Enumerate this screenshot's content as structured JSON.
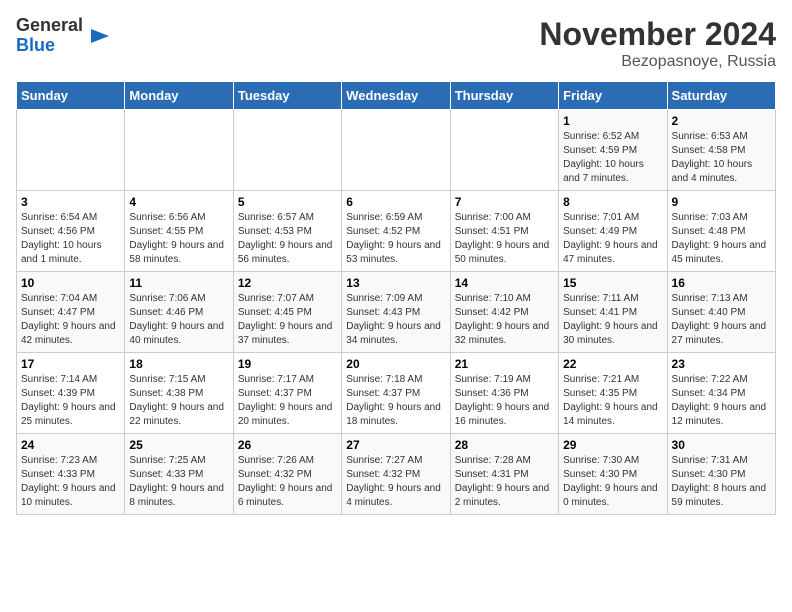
{
  "logo": {
    "general": "General",
    "blue": "Blue"
  },
  "title": "November 2024",
  "subtitle": "Bezopasnoye, Russia",
  "days_of_week": [
    "Sunday",
    "Monday",
    "Tuesday",
    "Wednesday",
    "Thursday",
    "Friday",
    "Saturday"
  ],
  "weeks": [
    [
      {
        "day": "",
        "info": ""
      },
      {
        "day": "",
        "info": ""
      },
      {
        "day": "",
        "info": ""
      },
      {
        "day": "",
        "info": ""
      },
      {
        "day": "",
        "info": ""
      },
      {
        "day": "1",
        "info": "Sunrise: 6:52 AM\nSunset: 4:59 PM\nDaylight: 10 hours and 7 minutes."
      },
      {
        "day": "2",
        "info": "Sunrise: 6:53 AM\nSunset: 4:58 PM\nDaylight: 10 hours and 4 minutes."
      }
    ],
    [
      {
        "day": "3",
        "info": "Sunrise: 6:54 AM\nSunset: 4:56 PM\nDaylight: 10 hours and 1 minute."
      },
      {
        "day": "4",
        "info": "Sunrise: 6:56 AM\nSunset: 4:55 PM\nDaylight: 9 hours and 58 minutes."
      },
      {
        "day": "5",
        "info": "Sunrise: 6:57 AM\nSunset: 4:53 PM\nDaylight: 9 hours and 56 minutes."
      },
      {
        "day": "6",
        "info": "Sunrise: 6:59 AM\nSunset: 4:52 PM\nDaylight: 9 hours and 53 minutes."
      },
      {
        "day": "7",
        "info": "Sunrise: 7:00 AM\nSunset: 4:51 PM\nDaylight: 9 hours and 50 minutes."
      },
      {
        "day": "8",
        "info": "Sunrise: 7:01 AM\nSunset: 4:49 PM\nDaylight: 9 hours and 47 minutes."
      },
      {
        "day": "9",
        "info": "Sunrise: 7:03 AM\nSunset: 4:48 PM\nDaylight: 9 hours and 45 minutes."
      }
    ],
    [
      {
        "day": "10",
        "info": "Sunrise: 7:04 AM\nSunset: 4:47 PM\nDaylight: 9 hours and 42 minutes."
      },
      {
        "day": "11",
        "info": "Sunrise: 7:06 AM\nSunset: 4:46 PM\nDaylight: 9 hours and 40 minutes."
      },
      {
        "day": "12",
        "info": "Sunrise: 7:07 AM\nSunset: 4:45 PM\nDaylight: 9 hours and 37 minutes."
      },
      {
        "day": "13",
        "info": "Sunrise: 7:09 AM\nSunset: 4:43 PM\nDaylight: 9 hours and 34 minutes."
      },
      {
        "day": "14",
        "info": "Sunrise: 7:10 AM\nSunset: 4:42 PM\nDaylight: 9 hours and 32 minutes."
      },
      {
        "day": "15",
        "info": "Sunrise: 7:11 AM\nSunset: 4:41 PM\nDaylight: 9 hours and 30 minutes."
      },
      {
        "day": "16",
        "info": "Sunrise: 7:13 AM\nSunset: 4:40 PM\nDaylight: 9 hours and 27 minutes."
      }
    ],
    [
      {
        "day": "17",
        "info": "Sunrise: 7:14 AM\nSunset: 4:39 PM\nDaylight: 9 hours and 25 minutes."
      },
      {
        "day": "18",
        "info": "Sunrise: 7:15 AM\nSunset: 4:38 PM\nDaylight: 9 hours and 22 minutes."
      },
      {
        "day": "19",
        "info": "Sunrise: 7:17 AM\nSunset: 4:37 PM\nDaylight: 9 hours and 20 minutes."
      },
      {
        "day": "20",
        "info": "Sunrise: 7:18 AM\nSunset: 4:37 PM\nDaylight: 9 hours and 18 minutes."
      },
      {
        "day": "21",
        "info": "Sunrise: 7:19 AM\nSunset: 4:36 PM\nDaylight: 9 hours and 16 minutes."
      },
      {
        "day": "22",
        "info": "Sunrise: 7:21 AM\nSunset: 4:35 PM\nDaylight: 9 hours and 14 minutes."
      },
      {
        "day": "23",
        "info": "Sunrise: 7:22 AM\nSunset: 4:34 PM\nDaylight: 9 hours and 12 minutes."
      }
    ],
    [
      {
        "day": "24",
        "info": "Sunrise: 7:23 AM\nSunset: 4:33 PM\nDaylight: 9 hours and 10 minutes."
      },
      {
        "day": "25",
        "info": "Sunrise: 7:25 AM\nSunset: 4:33 PM\nDaylight: 9 hours and 8 minutes."
      },
      {
        "day": "26",
        "info": "Sunrise: 7:26 AM\nSunset: 4:32 PM\nDaylight: 9 hours and 6 minutes."
      },
      {
        "day": "27",
        "info": "Sunrise: 7:27 AM\nSunset: 4:32 PM\nDaylight: 9 hours and 4 minutes."
      },
      {
        "day": "28",
        "info": "Sunrise: 7:28 AM\nSunset: 4:31 PM\nDaylight: 9 hours and 2 minutes."
      },
      {
        "day": "29",
        "info": "Sunrise: 7:30 AM\nSunset: 4:30 PM\nDaylight: 9 hours and 0 minutes."
      },
      {
        "day": "30",
        "info": "Sunrise: 7:31 AM\nSunset: 4:30 PM\nDaylight: 8 hours and 59 minutes."
      }
    ]
  ]
}
